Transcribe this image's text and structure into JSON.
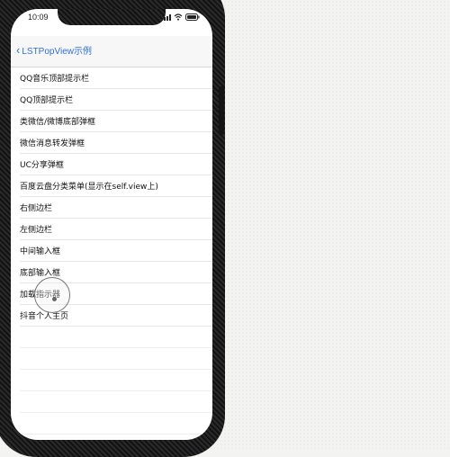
{
  "status_bar": {
    "time": "10:09",
    "icons": [
      "signal-icon",
      "wifi-icon",
      "battery-icon"
    ]
  },
  "nav_bar": {
    "back_icon": "‹",
    "back_label": "LSTPopView示例"
  },
  "list": {
    "items": [
      "QQ音乐顶部提示栏",
      "QQ顶部提示栏",
      "类微信/微博底部弹框",
      "微信消息转发弹框",
      "UC分享弹框",
      "百度云盘分类菜单(显示在self.view上)",
      "右侧边栏",
      "左侧边栏",
      "中间输入框",
      "底部输入框",
      "加载指示器",
      "抖音个人主页"
    ]
  },
  "colors": {
    "accent": "#2f6fd8",
    "background": "#f3f3f1"
  }
}
